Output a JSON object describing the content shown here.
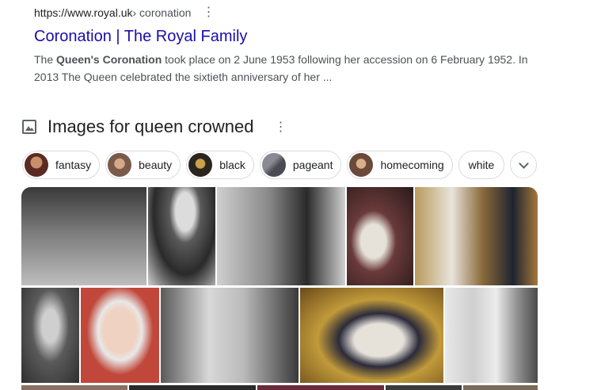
{
  "result": {
    "url": "https://www.royal.uk",
    "breadcrumb": " › coronation",
    "title": "Coronation | The Royal Family",
    "snippet_pre": "The ",
    "snippet_bold": "Queen's Coronation",
    "snippet_post": " took place on 2 June 1953 following her accession on 6 February 1952. In 2013 The Queen celebrated the sixtieth anniversary of her ..."
  },
  "images_section": {
    "heading": "Images for queen crowned",
    "chips": [
      {
        "label": "fantasy",
        "thumb_color": "#5a2a22"
      },
      {
        "label": "beauty",
        "thumb_color": "#7a5a48"
      },
      {
        "label": "black",
        "thumb_color": "#2b2520"
      },
      {
        "label": "pageant",
        "thumb_color": "#4a4a52"
      },
      {
        "label": "homecoming",
        "thumb_color": "#6b4a3a"
      },
      {
        "label": "white",
        "thumb_color": ""
      }
    ],
    "more_icon": "chevron-down-icon"
  },
  "image_tiles": [
    {
      "name": "image-tile-balcony-family",
      "color": "#6e6e6e"
    },
    {
      "name": "image-tile-queen-waving-bw",
      "color": "#8a8a8a"
    },
    {
      "name": "image-tile-queen-and-philip",
      "color": "#5a5a5a"
    },
    {
      "name": "image-tile-coronation-portrait-color",
      "color": "#5b3a3a"
    },
    {
      "name": "image-tile-queen-and-charles-throne",
      "color": "#8a6a3a"
    },
    {
      "name": "image-tile-young-queen-crown",
      "color": "#4f4f4f"
    },
    {
      "name": "image-tile-queen-smiling-tiara",
      "color": "#c0473a"
    },
    {
      "name": "image-tile-queen-with-sceptre-bw",
      "color": "#9a9a9a"
    },
    {
      "name": "image-tile-queen-state-opening",
      "color": "#8a6a2a"
    },
    {
      "name": "image-tile-queen-robes-standing",
      "color": "#b0b0b0"
    }
  ]
}
